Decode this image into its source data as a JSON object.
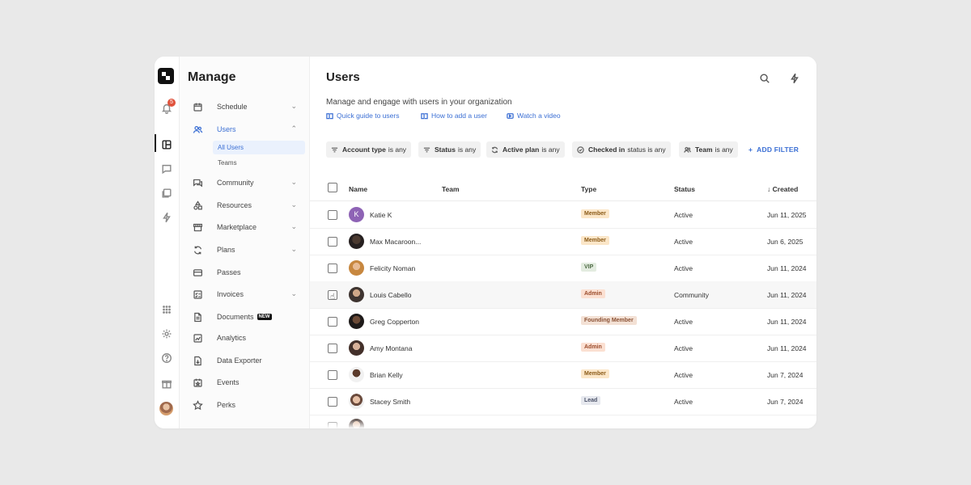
{
  "rail": {
    "notification_count": "5"
  },
  "sidebar": {
    "title": "Manage",
    "items": [
      {
        "label": "Schedule",
        "icon": "calendar-icon",
        "chevron": "⌄"
      },
      {
        "label": "Users",
        "icon": "users-icon",
        "chevron": "⌃",
        "active": true
      },
      {
        "label": "Community",
        "icon": "chat-icon",
        "chevron": "⌄"
      },
      {
        "label": "Resources",
        "icon": "shapes-icon",
        "chevron": "⌄"
      },
      {
        "label": "Marketplace",
        "icon": "store-icon",
        "chevron": "⌄"
      },
      {
        "label": "Plans",
        "icon": "refresh-icon",
        "chevron": "⌄"
      },
      {
        "label": "Passes",
        "icon": "wallet-icon"
      },
      {
        "label": "Invoices",
        "icon": "invoice-icon",
        "chevron": "⌄"
      },
      {
        "label": "Documents",
        "icon": "document-icon",
        "badge": "NEW"
      },
      {
        "label": "Analytics",
        "icon": "chart-icon"
      },
      {
        "label": "Data Exporter",
        "icon": "export-icon"
      },
      {
        "label": "Events",
        "icon": "event-icon"
      },
      {
        "label": "Perks",
        "icon": "star-icon"
      }
    ],
    "users_subitems": [
      {
        "label": "All Users",
        "active": true
      },
      {
        "label": "Teams"
      }
    ]
  },
  "main": {
    "title": "Users",
    "subtitle": "Manage and engage with users in your organization",
    "help_links": [
      "Quick guide to users",
      "How to add a user",
      "Watch a video"
    ],
    "filters": [
      {
        "bold": "Account type",
        "rest": "is any"
      },
      {
        "bold": "Status",
        "rest": "is any"
      },
      {
        "bold": "Active plan",
        "rest": "is any"
      },
      {
        "bold": "Checked in",
        "rest": "status is any"
      },
      {
        "bold": "Team",
        "rest": "is any"
      }
    ],
    "add_filter_label": "ADD FILTER"
  },
  "table": {
    "columns": [
      "Name",
      "Team",
      "Type",
      "Status",
      "Created"
    ],
    "sort_arrow": "↓",
    "rows": [
      {
        "name": "Katie K",
        "avatar_letter": "K",
        "type": "Member",
        "status": "Active",
        "created": "Jun 11, 2025"
      },
      {
        "name": "Max Macaroon...",
        "type": "Member",
        "status": "Active",
        "created": "Jun 6, 2025"
      },
      {
        "name": "Felicity Noman",
        "type": "VIP",
        "status": "Active",
        "created": "Jun 11, 2024"
      },
      {
        "name": "Louis Cabello",
        "type": "Admin",
        "status": "Community",
        "created": "Jun 11, 2024"
      },
      {
        "name": "Greg Copperton",
        "type": "Founding Member",
        "status": "Active",
        "created": "Jun 11, 2024"
      },
      {
        "name": "Amy Montana",
        "type": "Admin",
        "status": "Active",
        "created": "Jun 11, 2024"
      },
      {
        "name": "Brian Kelly",
        "type": "Member",
        "status": "Active",
        "created": "Jun 7, 2024"
      },
      {
        "name": "Stacey Smith",
        "type": "Lead",
        "status": "Active",
        "created": "Jun 7, 2024"
      }
    ]
  },
  "colors": {
    "accent": "#3b6fd4",
    "badge_member": "#fbe6c8",
    "badge_vip": "#e3ece0",
    "badge_admin": "#fbe0d2",
    "badge_founding": "#f3e1d5",
    "badge_lead": "#e6e8ee"
  }
}
